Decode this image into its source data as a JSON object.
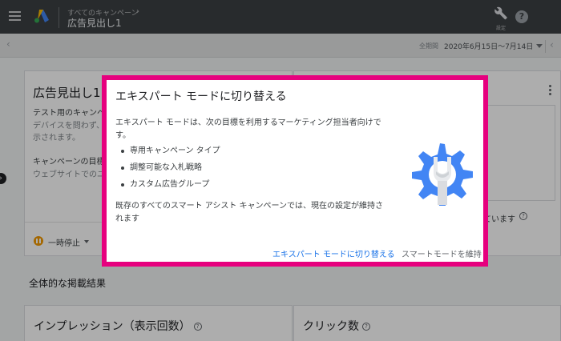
{
  "topbar": {
    "breadcrumb": "すべてのキャンペーン",
    "breadcrumb_chevron": "›",
    "title": "広告見出し1",
    "tools_label": "設定",
    "help_glyph": "?"
  },
  "datebar": {
    "range_label": "全期間",
    "range_value": "2020年6月15日〜7月14日",
    "side_chevron": "‹",
    "next_chevron": "‹"
  },
  "ad_card": {
    "title": "広告見出し1",
    "desc_lines": [
      "テスト用のキャンペ",
      "デバイスを問わず、",
      "示されます。"
    ],
    "goal_heading": "キャンペーンの目標",
    "goal_value": "ウェブサイトでのユ",
    "status_label": "一時停止"
  },
  "right_card": {
    "fragment": "ています",
    "help_glyph": "?"
  },
  "side_button_glyph": "›",
  "summary": {
    "section_title": "全体的な掲載結果",
    "impressions_label": "インプレッション（表示回数）",
    "clicks_label": "クリック数",
    "help_glyph": "?"
  },
  "dialog": {
    "title": "エキスパート モードに切り替える",
    "body": "エキスパート モードは、次の目標を利用するマーケティング担当者向けです。",
    "bullets": [
      "専用キャンペーン タイプ",
      "調整可能な入札戦略",
      "カスタム広告グループ"
    ],
    "footer": "既存のすべてのスマート アシスト キャンペーンでは、現在の設定が維持されます",
    "switch_label": "エキスパート モードに切り替える",
    "keep_label": "スマートモードを維持"
  },
  "colors": {
    "appbar": "#3c4043",
    "highlight": "#e6007e",
    "primary_link": "#1a73e8",
    "gear_blue": "#4285f4",
    "pause_amber": "#f29900"
  },
  "icons": [
    "menu-icon",
    "google-ads-logo",
    "wrench-icon",
    "help-icon",
    "chevron-down-icon",
    "more-vert-icon",
    "pause-icon",
    "gear-wrench-illustration"
  ]
}
